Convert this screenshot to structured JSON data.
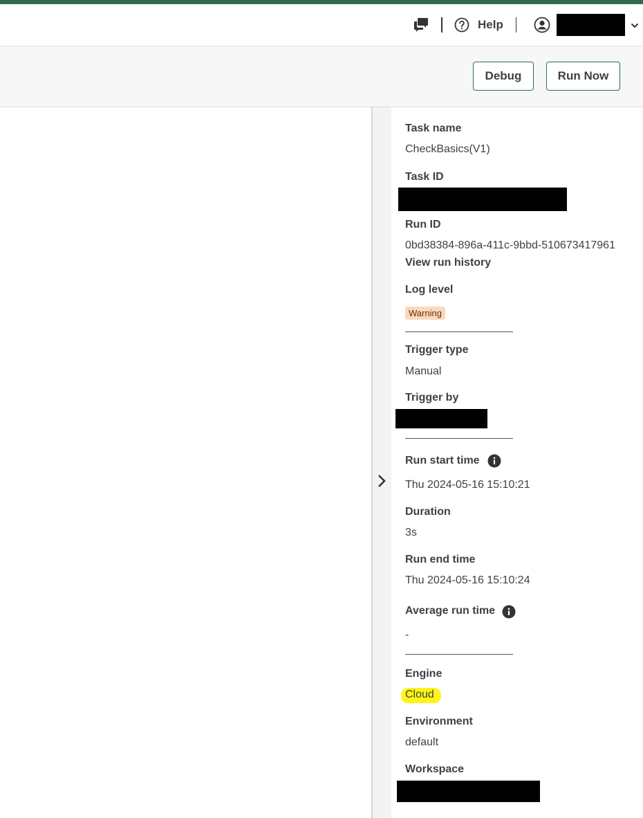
{
  "theme": {
    "brand_green": "#2e6b4f",
    "text": "#404040",
    "warning_bg": "#fbd9bd",
    "highlight": "#fff41a"
  },
  "header": {
    "help_label": "Help",
    "icons": [
      "chat-icon",
      "help-icon",
      "user-icon",
      "chevron-down-icon"
    ]
  },
  "toolbar": {
    "debug_label": "Debug",
    "run_now_label": "Run Now"
  },
  "details": {
    "task_name": {
      "label": "Task name",
      "value": "CheckBasics(V1)"
    },
    "task_id": {
      "label": "Task ID"
    },
    "run_id": {
      "label": "Run ID",
      "value": "0bd38384-896a-411c-9bbd-510673417961"
    },
    "view_run_history": "View run history",
    "log_level": {
      "label": "Log level",
      "value": "Warning"
    },
    "trigger_type": {
      "label": "Trigger type",
      "value": "Manual"
    },
    "trigger_by": {
      "label": "Trigger by"
    },
    "run_start_time": {
      "label": "Run start time",
      "value": "Thu 2024-05-16 15:10:21"
    },
    "duration": {
      "label": "Duration",
      "value": "3s"
    },
    "run_end_time": {
      "label": "Run end time",
      "value": "Thu 2024-05-16 15:10:24"
    },
    "average_run_time": {
      "label": "Average run time",
      "value": "-"
    },
    "engine": {
      "label": "Engine",
      "value": "Cloud"
    },
    "environment": {
      "label": "Environment",
      "value": "default"
    },
    "workspace": {
      "label": "Workspace"
    }
  }
}
